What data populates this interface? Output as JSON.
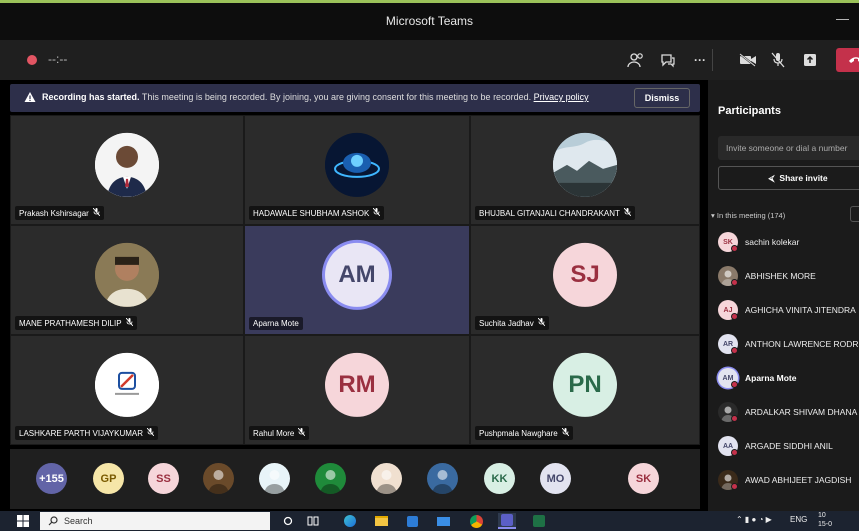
{
  "window": {
    "title": "Microsoft Teams",
    "minimize": "—"
  },
  "controls": {
    "timer": "--:--",
    "more": "···"
  },
  "banner": {
    "bold": "Recording has started.",
    "text": " This meeting is being recorded. By joining, you are giving consent for this meeting to be recorded. ",
    "link": "Privacy policy",
    "dismiss": "Dismiss"
  },
  "tiles": [
    {
      "name": "Prakash Kshirsagar",
      "initials": "",
      "photo": "photo-person",
      "bg": "#ffffff"
    },
    {
      "name": "HADAWALE SHUBHAM ASHOK",
      "initials": "",
      "photo": "photo-tech",
      "bg": "#0b1a3a"
    },
    {
      "name": "BHUJBAL GITANJALI CHANDRAKANT",
      "initials": "",
      "photo": "photo-landscape",
      "bg": "#9fb8c8"
    },
    {
      "name": "MANE PRATHAMESH DILIP",
      "initials": "",
      "photo": "photo-selfie",
      "bg": "#7a6a4a"
    },
    {
      "name": "Aparna Mote",
      "initials": "AM",
      "photo": "",
      "bg": "#e9e6f5"
    },
    {
      "name": "Suchita Jadhav",
      "initials": "SJ",
      "photo": "",
      "bg": "#f6d6da"
    },
    {
      "name": "LASHKARE PARTH VIJAYKUMAR",
      "initials": "",
      "photo": "photo-logo",
      "bg": "#ffffff"
    },
    {
      "name": "Rahul More",
      "initials": "RM",
      "photo": "",
      "bg": "#f6d6da"
    },
    {
      "name": "Pushpmala Nawghare",
      "initials": "PN",
      "photo": "",
      "bg": "#d8efe4"
    }
  ],
  "strip": [
    {
      "label": "+155",
      "bg": "#6264a7",
      "fg": "#ffffff"
    },
    {
      "label": "GP",
      "bg": "#f6e6a8",
      "fg": "#7a5a00"
    },
    {
      "label": "SS",
      "bg": "#f6d6da",
      "fg": "#9a3040"
    },
    {
      "label": "",
      "bg": "#6a4a2a",
      "fg": "#ffffff"
    },
    {
      "label": "",
      "bg": "#e8f4f8",
      "fg": "#333333"
    },
    {
      "label": "",
      "bg": "#1f8a3a",
      "fg": "#ffffff"
    },
    {
      "label": "",
      "bg": "#f0e0d0",
      "fg": "#333333"
    },
    {
      "label": "",
      "bg": "#3a6aa0",
      "fg": "#ffffff"
    },
    {
      "label": "KK",
      "bg": "#d8efe4",
      "fg": "#2a6a4a"
    },
    {
      "label": "MO",
      "bg": "#e2e3f0",
      "fg": "#44466a"
    },
    {
      "label": "SK",
      "bg": "#f6d6da",
      "fg": "#9a3040"
    }
  ],
  "panel": {
    "title": "Participants",
    "invite_placeholder": "Invite someone or dial a number",
    "share": "Share invite",
    "in_meeting": "In this meeting (174)"
  },
  "participants": [
    {
      "name": "sachin kolekar",
      "initials": "SK",
      "bg": "#f6d6da",
      "fg": "#9a3040",
      "bold": false
    },
    {
      "name": "ABHISHEK MORE",
      "initials": "",
      "bg": "#8a7a6a",
      "fg": "#fff",
      "bold": false
    },
    {
      "name": "AGHICHA VINITA JITENDRA",
      "initials": "AJ",
      "bg": "#f6d6da",
      "fg": "#9a3040",
      "bold": false
    },
    {
      "name": "ANTHON LAWRENCE RODR",
      "initials": "AR",
      "bg": "#e2e3f0",
      "fg": "#44466a",
      "bold": false
    },
    {
      "name": "Aparna Mote",
      "initials": "AM",
      "bg": "#e2e3f0",
      "fg": "#44466a",
      "bold": true
    },
    {
      "name": "ARDALKAR SHIVAM DHANA",
      "initials": "",
      "bg": "#2a2a2a",
      "fg": "#fff",
      "bold": false
    },
    {
      "name": "ARGADE SIDDHI ANIL",
      "initials": "AA",
      "bg": "#e2e3f0",
      "fg": "#44466a",
      "bold": false
    },
    {
      "name": "AWAD ABHIJEET JAGDISH",
      "initials": "",
      "bg": "#3a2a1a",
      "fg": "#fff",
      "bold": false
    }
  ],
  "taskbar": {
    "search": "Search",
    "lang": "ENG",
    "time": "10",
    "date": "15-0"
  }
}
